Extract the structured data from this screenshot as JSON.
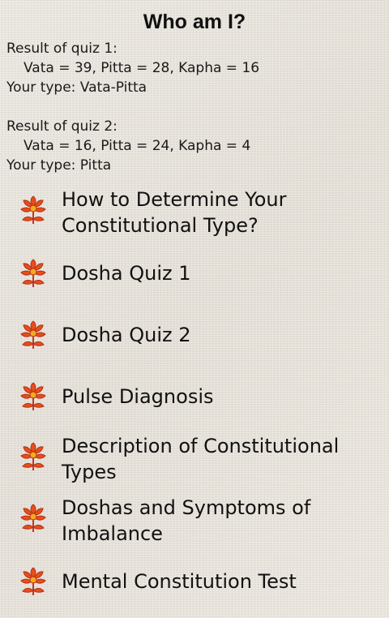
{
  "header": {
    "title": "Who am I?"
  },
  "results": [
    {
      "heading": "Result of quiz 1:",
      "scores": "Vata = 39, Pitta = 28, Kapha = 16",
      "type": "Your type: Vata-Pitta"
    },
    {
      "heading": "Result of quiz 2:",
      "scores": "Vata = 16, Pitta = 24, Kapha = 4",
      "type": "Your type: Pitta"
    }
  ],
  "menu": {
    "icon": "lotus-flower-icon",
    "icon_colors": {
      "petals": "#e84e1b",
      "petal_outline": "#c0392b",
      "center": "#f7a91e"
    },
    "items": [
      {
        "label": "How to Determine Your Constitutional Type?"
      },
      {
        "label": "Dosha Quiz 1"
      },
      {
        "label": "Dosha Quiz 2"
      },
      {
        "label": "Pulse Diagnosis"
      },
      {
        "label": "Description of Constitutional Types"
      },
      {
        "label": "Doshas and Symptoms of Imbalance"
      },
      {
        "label": "Mental Constitution Test"
      }
    ]
  }
}
